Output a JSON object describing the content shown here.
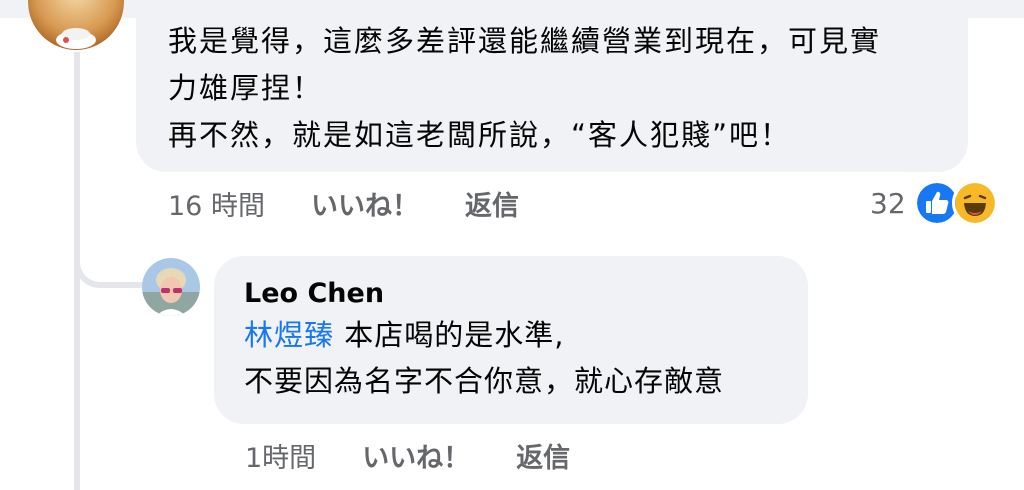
{
  "comment_1": {
    "lines": [
      "我是覺得，這麼多差評還能繼續營業到現在，可見實",
      "力雄厚捏！",
      "再不然，就是如這老闆所說，“客人犯賤”吧！"
    ],
    "time": "16 時間",
    "like_label": "いいね！",
    "reply_label": "返信",
    "reaction_count": "32",
    "reactions": [
      "like-icon",
      "haha-icon"
    ]
  },
  "comment_2": {
    "author": "Leo Chen",
    "mention": "林煜臻",
    "line_1_rest": "本店喝的是水準,",
    "line_2": "不要因為名字不合你意，就心存敵意",
    "time": "1時間",
    "like_label": "いいね！",
    "reply_label": "返信"
  },
  "colors": {
    "bubble": "#f0f2f5",
    "meta_text": "#65676b",
    "mention": "#1877f2",
    "like_blue": "#1877f2",
    "haha_yellow": "#f7b928"
  }
}
